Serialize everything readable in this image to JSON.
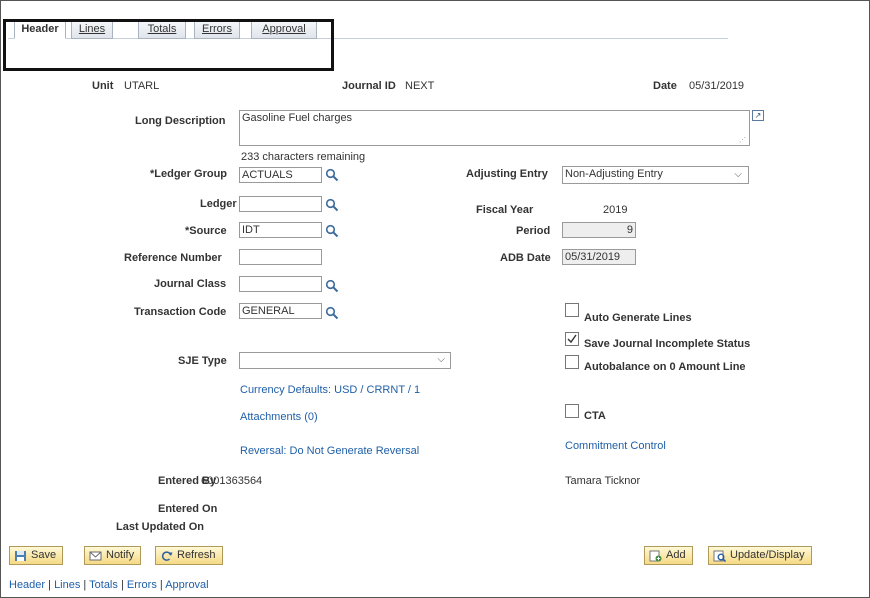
{
  "tabs": [
    "Header",
    "Lines",
    "Totals",
    "Errors",
    "Approval"
  ],
  "header": {
    "unit_label": "Unit",
    "unit_value": "UTARL",
    "journal_id_label": "Journal ID",
    "journal_id_value": "NEXT",
    "date_label": "Date",
    "date_value": "05/31/2019"
  },
  "long_description": {
    "label": "Long Description",
    "value": "Gasoline Fuel charges",
    "remaining": "233 characters remaining"
  },
  "ledger_group": {
    "label": "*Ledger Group",
    "value": "ACTUALS"
  },
  "ledger": {
    "label": "Ledger",
    "value": ""
  },
  "source": {
    "label": "*Source",
    "value": "IDT"
  },
  "reference_number": {
    "label": "Reference Number",
    "value": ""
  },
  "journal_class": {
    "label": "Journal Class",
    "value": ""
  },
  "transaction_code": {
    "label": "Transaction Code",
    "value": "GENERAL"
  },
  "sje_type": {
    "label": "SJE Type",
    "value": ""
  },
  "adjusting_entry": {
    "label": "Adjusting Entry",
    "value": "Non-Adjusting Entry"
  },
  "fiscal_year": {
    "label": "Fiscal Year",
    "value": "2019"
  },
  "period": {
    "label": "Period",
    "value": "9"
  },
  "adb_date": {
    "label": "ADB Date",
    "value": "05/31/2019"
  },
  "checkboxes": {
    "auto_generate": {
      "label": "Auto Generate Lines",
      "checked": false
    },
    "save_incomplete": {
      "label": "Save Journal Incomplete Status",
      "checked": true
    },
    "autobalance": {
      "label": "Autobalance on 0 Amount Line",
      "checked": false
    },
    "cta": {
      "label": "CTA",
      "checked": false
    }
  },
  "links": {
    "currency_defaults": "Currency Defaults: USD / CRRNT / 1",
    "attachments": "Attachments (0)",
    "reversal": "Reversal: Do Not Generate Reversal",
    "commitment_control": "Commitment Control"
  },
  "entered_by": {
    "label": "Entered By",
    "id": "6001363564",
    "name": "Tamara Ticknor"
  },
  "entered_on": {
    "label": "Entered On",
    "value": ""
  },
  "last_updated_on": {
    "label": "Last Updated On",
    "value": ""
  },
  "buttons": {
    "save": "Save",
    "notify": "Notify",
    "refresh": "Refresh",
    "add": "Add",
    "update_display": "Update/Display"
  },
  "footer_links": [
    "Header",
    "Lines",
    "Totals",
    "Errors",
    "Approval"
  ],
  "colors": {
    "link": "#1f5fa8",
    "button_top": "#fff9d6",
    "button_bottom": "#f5d985",
    "tab_border": "#a9b4c0"
  }
}
